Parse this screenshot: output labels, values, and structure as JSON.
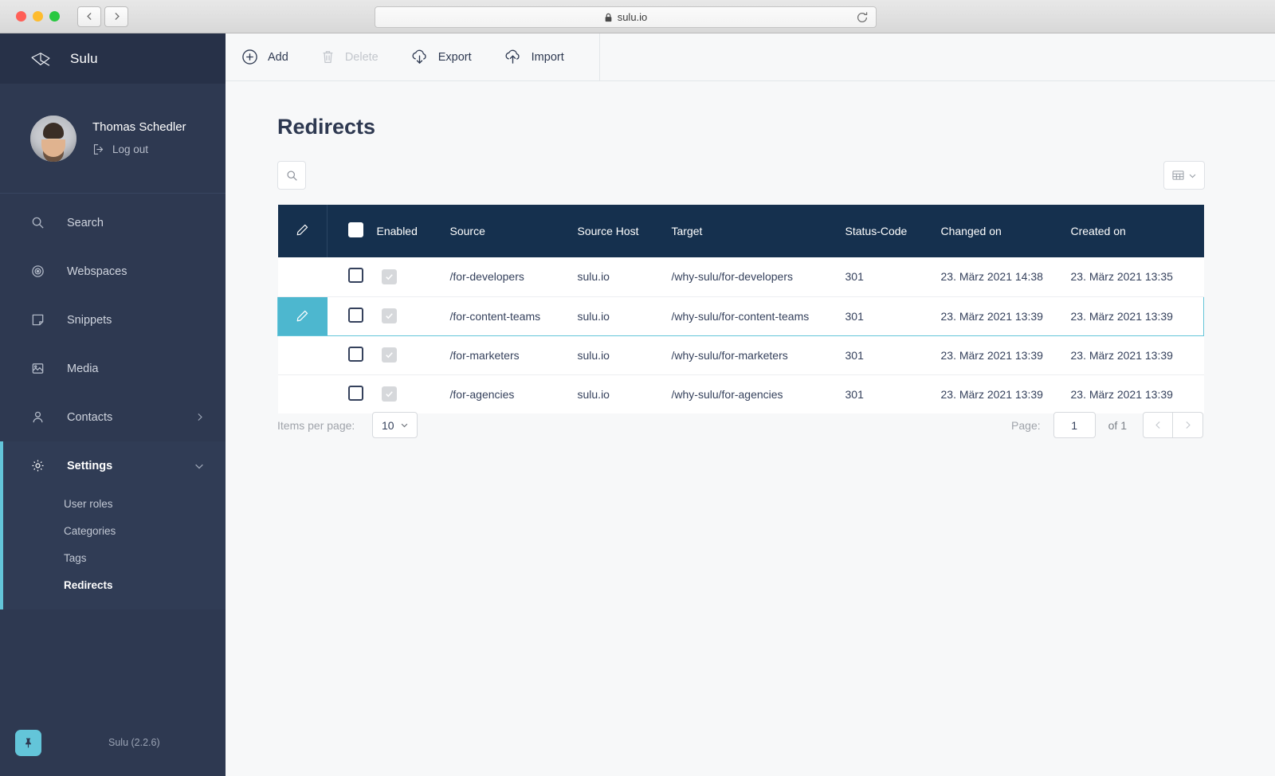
{
  "browser": {
    "url": "sulu.io",
    "lock_icon": "lock-icon",
    "back_icon": "chevron-left-icon",
    "forward_icon": "chevron-right-icon",
    "reload_icon": "reload-icon"
  },
  "sidebar": {
    "brand": "Sulu",
    "brand_icon": "sulu-logo-icon",
    "user": {
      "name": "Thomas Schedler",
      "logout_label": "Log out",
      "logout_icon": "logout-icon"
    },
    "items": [
      {
        "label": "Search",
        "icon": "search-icon",
        "active": false,
        "chevron": ""
      },
      {
        "label": "Webspaces",
        "icon": "target-icon",
        "active": false,
        "chevron": ""
      },
      {
        "label": "Snippets",
        "icon": "snippet-icon",
        "active": false,
        "chevron": ""
      },
      {
        "label": "Media",
        "icon": "image-icon",
        "active": false,
        "chevron": ""
      },
      {
        "label": "Contacts",
        "icon": "user-icon",
        "active": false,
        "chevron": "chevron-right-icon"
      },
      {
        "label": "Settings",
        "icon": "gear-icon",
        "active": true,
        "chevron": "chevron-down-icon"
      }
    ],
    "subitems": [
      {
        "label": "User roles",
        "active": false
      },
      {
        "label": "Categories",
        "active": false
      },
      {
        "label": "Tags",
        "active": false
      },
      {
        "label": "Redirects",
        "active": true
      }
    ],
    "footer": {
      "pin_icon": "pin-icon",
      "version": "Sulu (2.2.6)"
    }
  },
  "toolbar": {
    "add_label": "Add",
    "add_icon": "plus-circle-icon",
    "delete_label": "Delete",
    "delete_icon": "trash-icon",
    "export_label": "Export",
    "export_icon": "cloud-download-icon",
    "import_label": "Import",
    "import_icon": "cloud-upload-icon"
  },
  "main": {
    "title": "Redirects",
    "search_icon": "search-icon",
    "view_toggle_icon": "table-view-icon",
    "view_toggle_chevron": "chevron-down-icon"
  },
  "table": {
    "edit_header_icon": "pencil-icon",
    "columns": [
      "Enabled",
      "Source",
      "Source Host",
      "Target",
      "Status-Code",
      "Changed on",
      "Created on"
    ],
    "rows": [
      {
        "selected": false,
        "enabled": true,
        "source": "/for-developers",
        "source_host": "sulu.io",
        "target": "/why-sulu/for-developers",
        "status_code": "301",
        "changed_on": "23. März 2021 14:38",
        "created_on": "23. März 2021 13:35"
      },
      {
        "selected": true,
        "enabled": true,
        "source": "/for-content-teams",
        "source_host": "sulu.io",
        "target": "/why-sulu/for-content-teams",
        "status_code": "301",
        "changed_on": "23. März 2021 13:39",
        "created_on": "23. März 2021 13:39"
      },
      {
        "selected": false,
        "enabled": true,
        "source": "/for-marketers",
        "source_host": "sulu.io",
        "target": "/why-sulu/for-marketers",
        "status_code": "301",
        "changed_on": "23. März 2021 13:39",
        "created_on": "23. März 2021 13:39"
      },
      {
        "selected": false,
        "enabled": true,
        "source": "/for-agencies",
        "source_host": "sulu.io",
        "target": "/why-sulu/for-agencies",
        "status_code": "301",
        "changed_on": "23. März 2021 13:39",
        "created_on": "23. März 2021 13:39"
      }
    ]
  },
  "pagination": {
    "items_per_page_label": "Items per page:",
    "items_per_page_value": "10",
    "page_label": "Page:",
    "page_value": "1",
    "of_label": "of 1",
    "prev_icon": "chevron-left-icon",
    "next_icon": "chevron-right-icon"
  },
  "colors": {
    "sidebar_bg": "#2e3951",
    "sidebar_active": "#303c55",
    "accent_teal": "#63c5d9",
    "accent_teal_dark": "#4db7cf",
    "table_header": "#15304e",
    "page_bg": "#f7f8f9",
    "text_dark": "#35415c"
  }
}
